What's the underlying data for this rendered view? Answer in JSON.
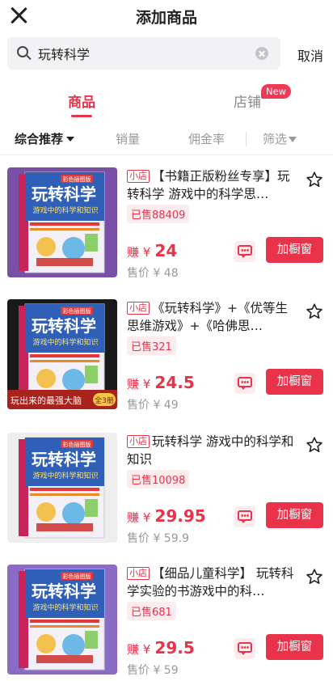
{
  "header": {
    "title": "添加商品"
  },
  "search": {
    "value": "玩转科学",
    "cancel_label": "取消"
  },
  "tabs": [
    {
      "label": "商品"
    },
    {
      "label": "店铺",
      "badge": "New"
    }
  ],
  "sort": {
    "comprehensive": "综合推荐",
    "sales": "销量",
    "commission": "佣金率",
    "filter": "筛选"
  },
  "colors": {
    "accent": "#e8334a"
  },
  "product_common": {
    "shop_tag": "小店",
    "earn_label": "赚 ¥",
    "add_label": "加橱窗"
  },
  "products": [
    {
      "title": "【书籍正版粉丝专享】玩转科学 游戏中的科学思…",
      "sold": "已售88409",
      "earn": "24",
      "price": "售价 ¥ 48",
      "cover": {
        "series": "彩色插图版",
        "big_title": "玩转科学",
        "subtitle": "游戏中的科学和知识"
      }
    },
    {
      "title": "《玩转科学》+《优等生思维游戏》+《哈佛思…",
      "sold": "已售321",
      "earn": "24.5",
      "price": "售价 ¥ 49",
      "cover": {
        "series": "彩色插图版",
        "big_title": "玩转科学",
        "subtitle": "游戏中的科学和知识",
        "banner": "玩出来的最强大脑",
        "banner_badge": "全3册"
      }
    },
    {
      "title": "玩转科学 游戏中的科学和知识",
      "sold": "已售10098",
      "earn": "29.95",
      "price": "售价 ¥ 59.9",
      "cover": {
        "series": "彩色插图版",
        "big_title": "玩转科学",
        "subtitle": "游戏中的科学和知识"
      }
    },
    {
      "title": "【细品儿童科学】 玩转科学实验的书游戏中的科…",
      "sold": "已售681",
      "earn": "29.5",
      "price": "售价 ¥ 59",
      "cover": {
        "series": "彩色插图版",
        "big_title": "玩转科学",
        "subtitle": "游戏中的科学和知识"
      }
    }
  ]
}
